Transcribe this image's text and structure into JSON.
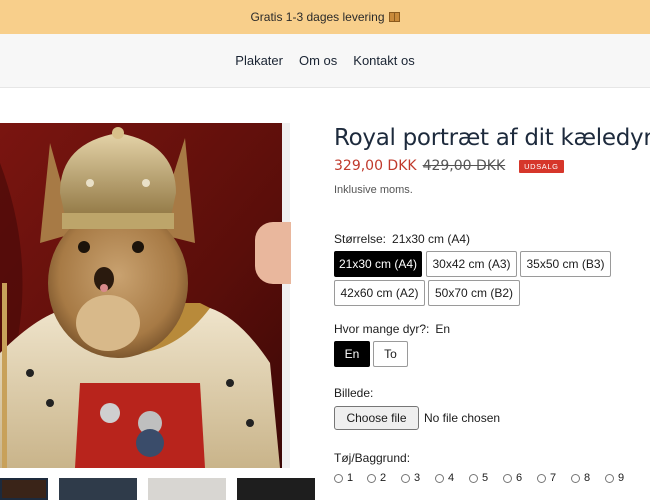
{
  "announcement": {
    "text": "Gratis 1-3 dages levering",
    "icon": "package-icon"
  },
  "nav": {
    "items": [
      "Plakater",
      "Om os",
      "Kontakt os"
    ]
  },
  "product": {
    "title": "Royal portræt af dit kæledyr",
    "price": "329,00 DKK",
    "compare_price": "429,00 DKK",
    "badge": "UDSALG",
    "tax_note": "Inklusive moms."
  },
  "options": {
    "size": {
      "label": "Størrelse:",
      "selected": "21x30 cm (A4)",
      "choices": [
        "21x30 cm (A4)",
        "30x42 cm (A3)",
        "35x50 cm (B3)",
        "42x60 cm (A2)",
        "50x70 cm (B2)"
      ]
    },
    "pets": {
      "label": "Hvor mange dyr?:",
      "selected": "En",
      "choices": [
        "En",
        "To"
      ]
    },
    "image": {
      "label": "Billede:",
      "button": "Choose file",
      "status": "No file chosen"
    },
    "background": {
      "label": "Tøj/Baggrund:",
      "choices": [
        "1",
        "2",
        "3",
        "4",
        "5",
        "6",
        "7",
        "8",
        "9"
      ]
    }
  },
  "colors": {
    "accent_price": "#c0392b",
    "badge_bg": "#d6362a",
    "announcement_bg": "#f8cf8b",
    "selected_chip": "#000000"
  }
}
